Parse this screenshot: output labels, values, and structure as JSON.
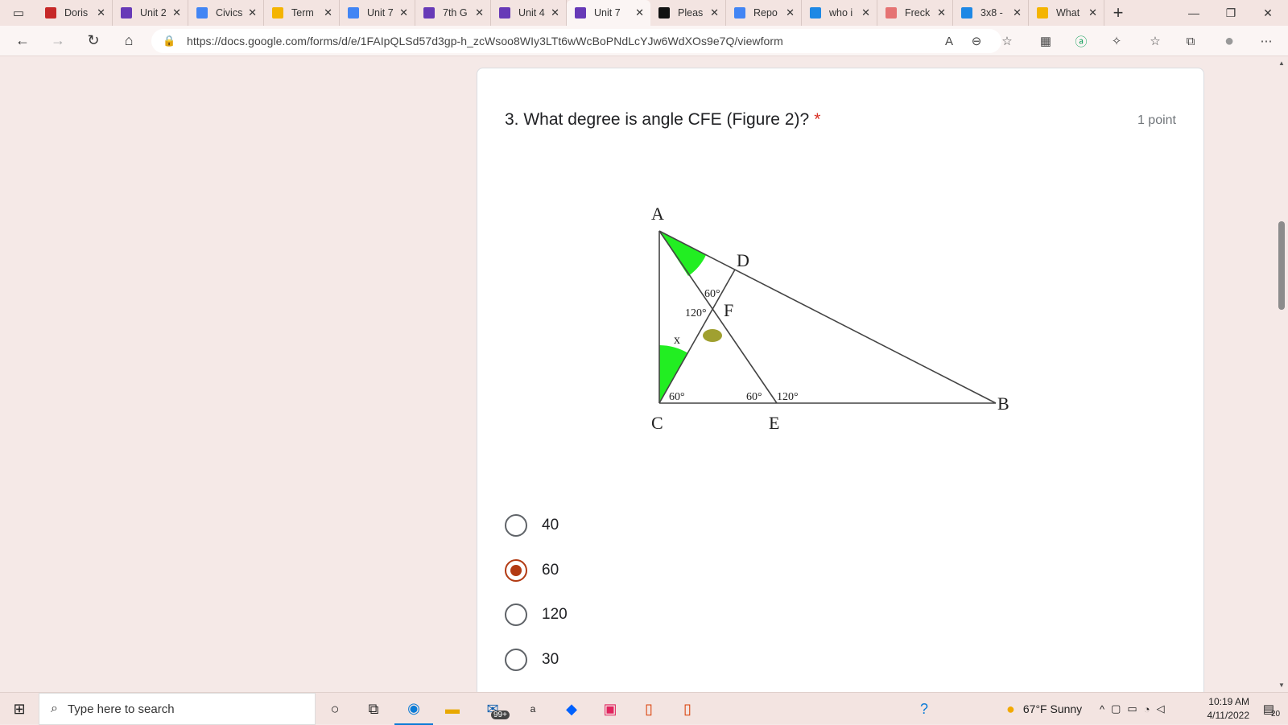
{
  "browser": {
    "tabs": [
      {
        "label": "Doris",
        "color": "#c62828",
        "icon": "doris-x-icon"
      },
      {
        "label": "Unit 2",
        "color": "#673ab7",
        "icon": "google-forms-icon"
      },
      {
        "label": "Civics",
        "color": "#4285f4",
        "icon": "google-docs-icon"
      },
      {
        "label": "Term",
        "color": "#f4b400",
        "icon": "google-slides-icon"
      },
      {
        "label": "Unit 7",
        "color": "#4285f4",
        "icon": "google-docs-icon"
      },
      {
        "label": "7th G",
        "color": "#673ab7",
        "icon": "google-forms-icon"
      },
      {
        "label": "Unit 4",
        "color": "#673ab7",
        "icon": "google-forms-icon"
      },
      {
        "label": "Unit 7",
        "color": "#673ab7",
        "icon": "google-forms-icon",
        "active": true
      },
      {
        "label": "Pleas",
        "color": "#111111",
        "icon": "notion-icon"
      },
      {
        "label": "Repo",
        "color": "#4285f4",
        "icon": "google-docs-icon"
      },
      {
        "label": "who i",
        "color": "#1e88e5",
        "icon": "bing-icon"
      },
      {
        "label": "Freck",
        "color": "#e57373",
        "icon": "pig-icon"
      },
      {
        "label": "3x8 -",
        "color": "#1e88e5",
        "icon": "bing-icon"
      },
      {
        "label": "What",
        "color": "#f4b400",
        "icon": "google-slides-icon"
      }
    ],
    "url": "https://docs.google.com/forms/d/e/1FAIpQLSd57d3gp-h_zcWsoo8WIy3LTt6wWcBoPNdLcYJw6WdXOs9e7Q/viewform",
    "close_glyph": "✕",
    "new_tab_glyph": "+"
  },
  "question": {
    "title": "3. What degree is angle CFE (Figure 2)?",
    "required_mark": "*",
    "points": "1 point",
    "figure": {
      "labels": {
        "A": "A",
        "B": "B",
        "C": "C",
        "D": "D",
        "E": "E",
        "F": "F",
        "x": "x"
      },
      "angles": {
        "afd": "60°",
        "afc": "120°",
        "c": "60°",
        "e_in": "60°",
        "e_out": "120°"
      },
      "fill_green": "#22ee22",
      "fill_olive": "#a0a030"
    },
    "options": [
      {
        "label": "40",
        "selected": false
      },
      {
        "label": "60",
        "selected": true
      },
      {
        "label": "120",
        "selected": false
      },
      {
        "label": "30",
        "selected": false
      }
    ]
  },
  "taskbar": {
    "search_placeholder": "Type here to search",
    "mail_badge": "99+",
    "weather": "67°F  Sunny",
    "time": "10:19 AM",
    "date": "4/11/2022",
    "notification_count": "20"
  }
}
